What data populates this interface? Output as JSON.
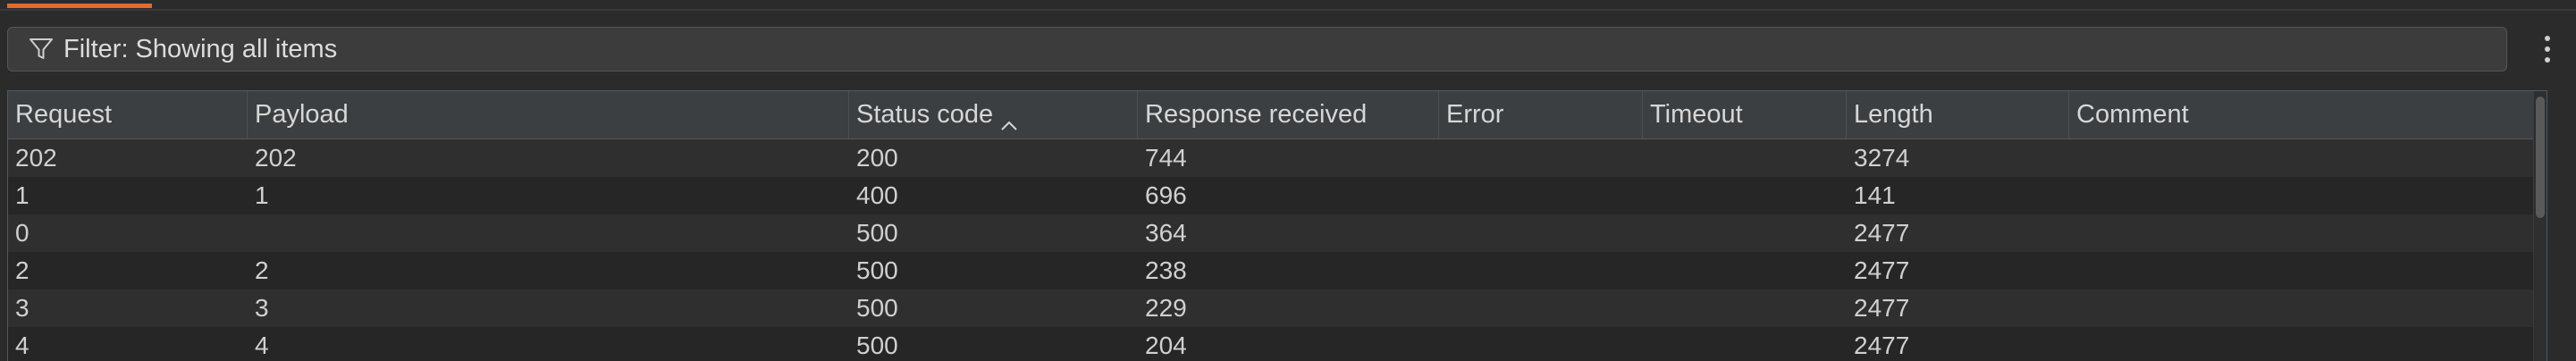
{
  "filter": {
    "label": "Filter: Showing all items",
    "icon": "funnel-icon"
  },
  "menu": {
    "icon": "vertical-ellipsis-icon"
  },
  "colors": {
    "accent": "#e36a2c",
    "background": "#2b2b2b",
    "header": "#3c3f41"
  },
  "table": {
    "columns": {
      "request": "Request",
      "payload": "Payload",
      "status_code": "Status code",
      "response_received": "Response received",
      "error": "Error",
      "timeout": "Timeout",
      "length": "Length",
      "comment": "Comment"
    },
    "sort": {
      "column": "Status code",
      "direction": "ascending",
      "icon": "sort-ascending-icon"
    },
    "rows": [
      {
        "request": "202",
        "payload": "202",
        "status_code": "200",
        "response_received": "744",
        "error": "",
        "timeout": "",
        "length": "3274",
        "comment": ""
      },
      {
        "request": "1",
        "payload": "1",
        "status_code": "400",
        "response_received": "696",
        "error": "",
        "timeout": "",
        "length": "141",
        "comment": ""
      },
      {
        "request": "0",
        "payload": "",
        "status_code": "500",
        "response_received": "364",
        "error": "",
        "timeout": "",
        "length": "2477",
        "comment": ""
      },
      {
        "request": "2",
        "payload": "2",
        "status_code": "500",
        "response_received": "238",
        "error": "",
        "timeout": "",
        "length": "2477",
        "comment": ""
      },
      {
        "request": "3",
        "payload": "3",
        "status_code": "500",
        "response_received": "229",
        "error": "",
        "timeout": "",
        "length": "2477",
        "comment": ""
      },
      {
        "request": "4",
        "payload": "4",
        "status_code": "500",
        "response_received": "204",
        "error": "",
        "timeout": "",
        "length": "2477",
        "comment": ""
      }
    ]
  }
}
